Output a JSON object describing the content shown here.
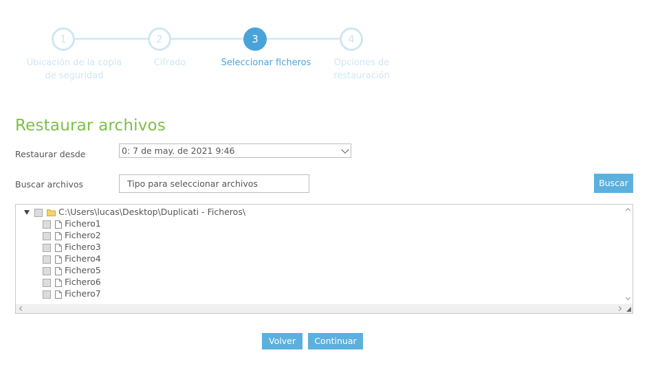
{
  "stepper": {
    "steps": [
      {
        "number": "1",
        "label_line1": "Ubicación de la copia",
        "label_line2": "de seguridad",
        "state": "inactive"
      },
      {
        "number": "2",
        "label_line1": "Cifrado",
        "label_line2": "",
        "state": "inactive"
      },
      {
        "number": "3",
        "label_line1": "Seleccionar ficheros",
        "label_line2": "",
        "state": "active"
      },
      {
        "number": "4",
        "label_line1": "Opciones de",
        "label_line2": "restauración",
        "state": "inactive"
      }
    ]
  },
  "page": {
    "title": "Restaurar archivos"
  },
  "restore_from": {
    "label": "Restaurar desde",
    "selected": "0: 7 de may. de 2021 9:46"
  },
  "search": {
    "label": "Buscar archivos",
    "placeholder": "Tipo para seleccionar archivos",
    "button_label": "Buscar"
  },
  "tree": {
    "root_path": "C:\\Users\\lucas\\Desktop\\Duplicati - Ficheros\\",
    "files": [
      "Fichero1",
      "Fichero2",
      "Fichero3",
      "Fichero4",
      "Fichero5",
      "Fichero6",
      "Fichero7"
    ]
  },
  "actions": {
    "back_label": "Volver",
    "continue_label": "Continuar"
  },
  "colors": {
    "accent_blue": "#4aa3d8",
    "button_blue": "#5bb0de",
    "title_green": "#7ac143",
    "inactive_step": "#cfe6f4"
  }
}
